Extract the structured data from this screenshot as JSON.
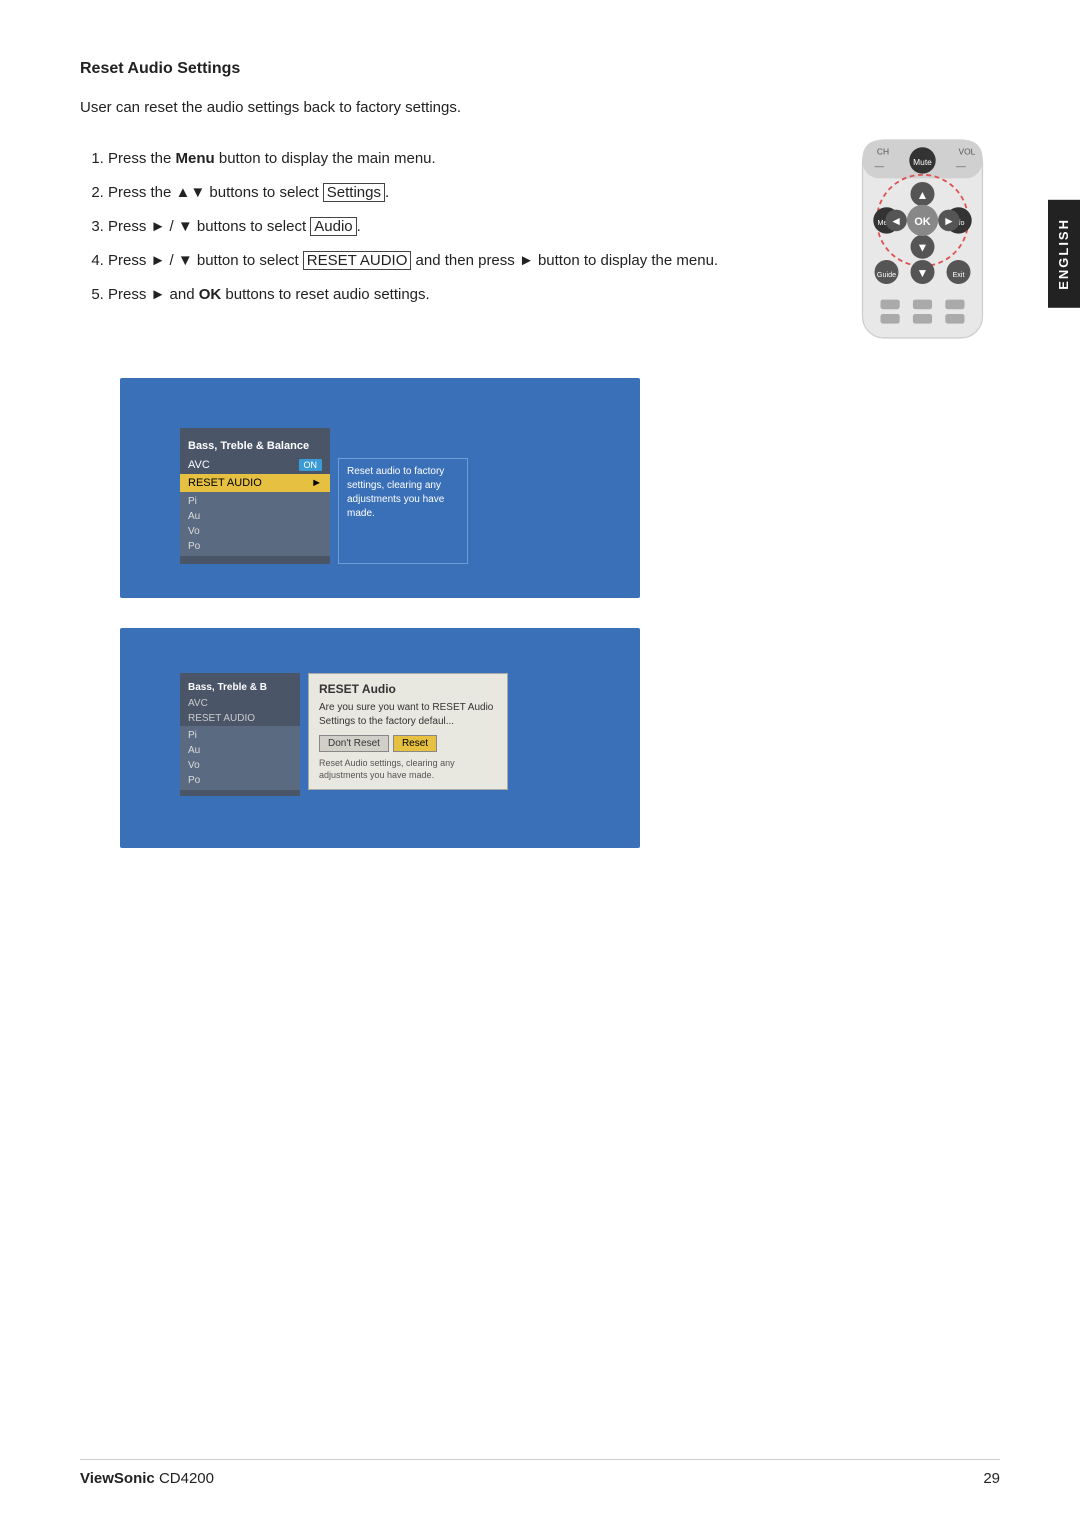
{
  "page": {
    "title": "Reset Audio Settings",
    "intro": "User can reset the audio settings back to factory settings.",
    "steps": [
      {
        "id": 1,
        "text": "Press the ",
        "bold": "Menu",
        "rest": " button to display the main menu."
      },
      {
        "id": 2,
        "text": "Press the ▲▼ buttons to select ",
        "boxed": "Settings",
        "rest": ""
      },
      {
        "id": 3,
        "text": "Press ► / ▼ buttons to select ",
        "boxed": "Audio",
        "rest": ""
      },
      {
        "id": 4,
        "text": "Press ► / ▼  button to select ",
        "boxed": "RESET AUDIO",
        "rest": " and then press ► button to display the menu."
      },
      {
        "id": 5,
        "text": "Press ► and ",
        "bold": "OK",
        "rest": " buttons to reset audio settings."
      }
    ],
    "screenshot1": {
      "menu_header": "Bass, Treble & Balance",
      "menu_items": [
        {
          "label": "AVC",
          "badge": "ON"
        },
        {
          "label": "RESET AUDIO",
          "selected": true
        }
      ],
      "side_items": [
        "Pi",
        "Au",
        "Vo",
        "Po"
      ],
      "tooltip": "Reset audio to factory settings, clearing any adjustments you have made."
    },
    "screenshot2": {
      "menu_header": "Bass, Treble & B",
      "menu_items": [
        {
          "label": "AVC"
        },
        {
          "label": "RESET AUDIO"
        }
      ],
      "side_items": [
        "Pi",
        "Au",
        "Vo",
        "Po"
      ],
      "dialog_title": "RESET Audio",
      "dialog_text": "Are you sure you want to RESET Audio Settings to the factory defaul...",
      "btn_no": "Don't Reset",
      "btn_yes": "Reset",
      "dialog_note": "Reset Audio settings, clearing any adjustments you have made."
    }
  },
  "footer": {
    "brand": "ViewSonic",
    "model": "CD4200",
    "page_number": "29"
  },
  "english_label": "ENGLISH"
}
